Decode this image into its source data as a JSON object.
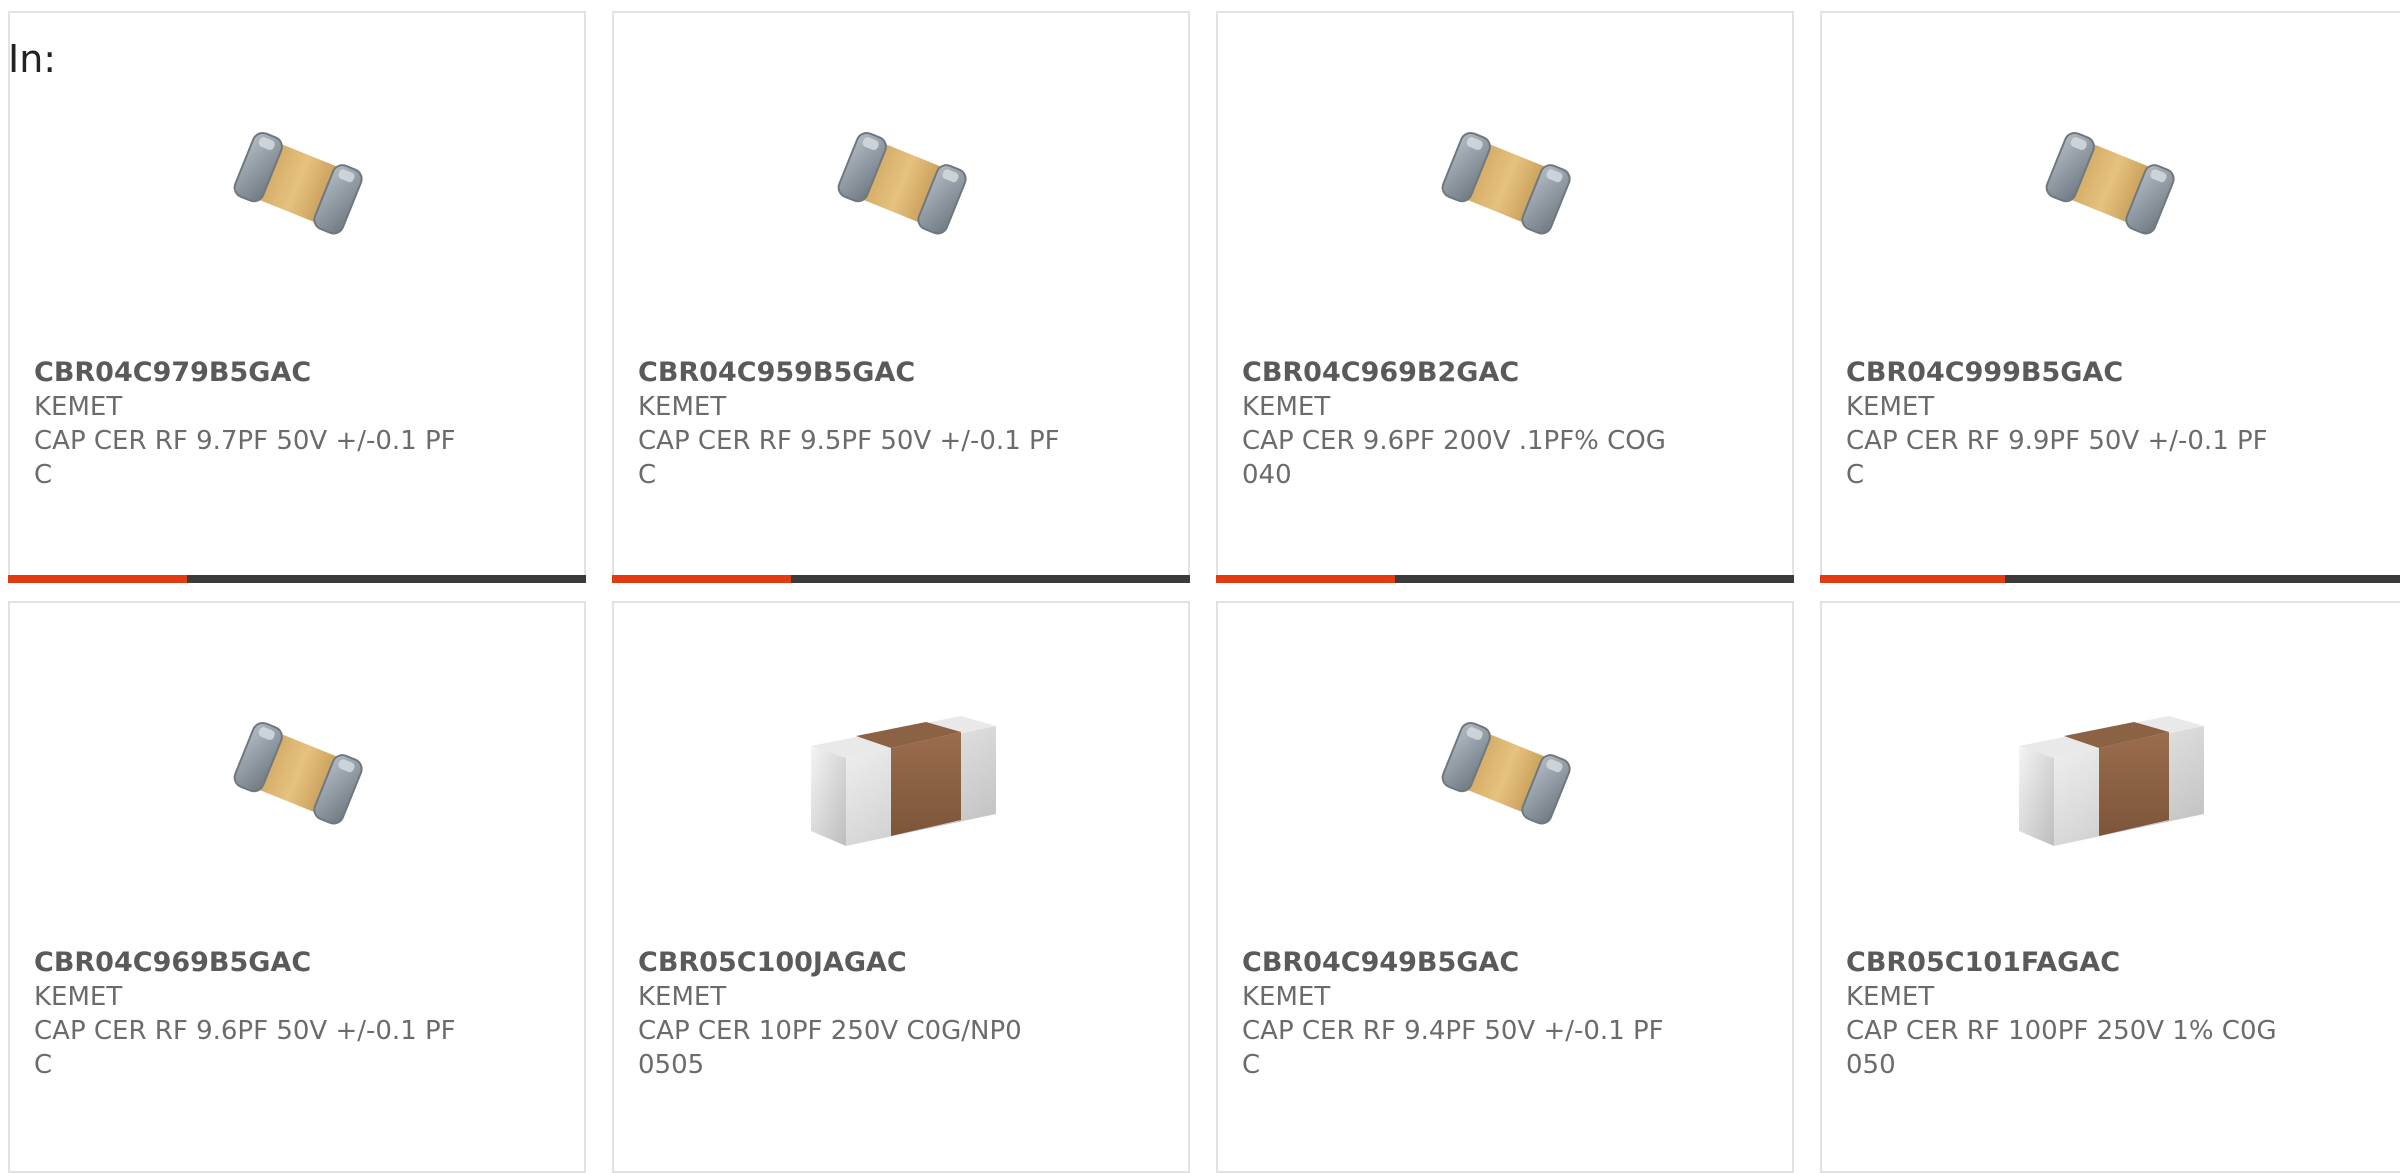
{
  "header": {
    "label": "In:"
  },
  "colors": {
    "accent": "#e23b12",
    "bar_track": "#3b3b3b"
  },
  "products": [
    {
      "part": "CBR04C979B5GAC",
      "brand": "KEMET",
      "desc_line1": "CAP CER RF 9.7PF 50V +/-0.1 PF",
      "desc_line2": "C",
      "image": "capacitor-0402-tan",
      "progress": 0.31
    },
    {
      "part": "CBR04C959B5GAC",
      "brand": "KEMET",
      "desc_line1": "CAP CER RF 9.5PF 50V +/-0.1 PF",
      "desc_line2": "C",
      "image": "capacitor-0402-tan",
      "progress": 0.31
    },
    {
      "part": "CBR04C969B2GAC",
      "brand": "KEMET",
      "desc_line1": "CAP CER 9.6PF 200V .1PF% COG",
      "desc_line2": "040",
      "image": "capacitor-0402-tan",
      "progress": 0.31
    },
    {
      "part": "CBR04C999B5GAC",
      "brand": "KEMET",
      "desc_line1": "CAP CER RF 9.9PF 50V +/-0.1 PF",
      "desc_line2": "C",
      "image": "capacitor-0402-tan",
      "progress": 0.31
    },
    {
      "part": "CBR04C969B5GAC",
      "brand": "KEMET",
      "desc_line1": "CAP CER RF 9.6PF 50V +/-0.1 PF",
      "desc_line2": "C",
      "image": "capacitor-0402-tan"
    },
    {
      "part": "CBR05C100JAGAC",
      "brand": "KEMET",
      "desc_line1": "CAP CER 10PF 250V C0G/NP0",
      "desc_line2": "0505",
      "image": "capacitor-0505-brown"
    },
    {
      "part": "CBR04C949B5GAC",
      "brand": "KEMET",
      "desc_line1": "CAP CER RF 9.4PF 50V +/-0.1 PF",
      "desc_line2": "C",
      "image": "capacitor-0402-tan"
    },
    {
      "part": "CBR05C101FAGAC",
      "brand": "KEMET",
      "desc_line1": "CAP CER RF 100PF 250V 1% C0G",
      "desc_line2": "050",
      "image": "capacitor-0505-brown"
    }
  ]
}
